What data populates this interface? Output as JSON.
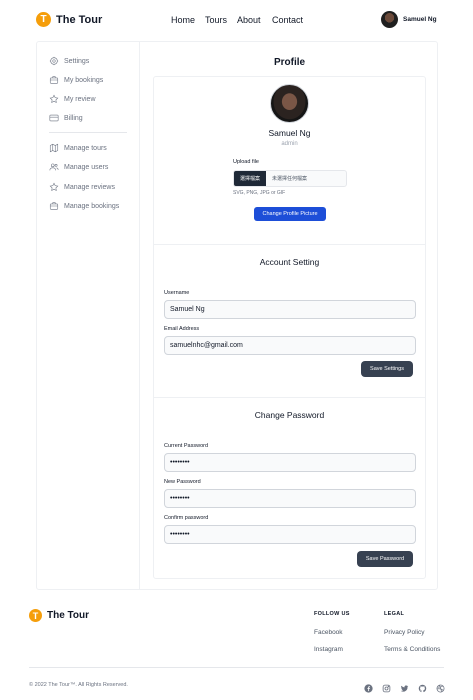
{
  "brand": {
    "logo_letter": "T",
    "name": "The Tour",
    "accent": "#f59e0b"
  },
  "nav": {
    "home": "Home",
    "tours": "Tours",
    "about": "About",
    "contact": "Contact"
  },
  "user": {
    "name": "Samuel Ng"
  },
  "sidebar": {
    "items": [
      {
        "label": "Settings",
        "icon": "gear-icon"
      },
      {
        "label": "My bookings",
        "icon": "briefcase-icon"
      },
      {
        "label": "My review",
        "icon": "star-icon"
      },
      {
        "label": "Billing",
        "icon": "credit-card-icon"
      }
    ],
    "admin_items": [
      {
        "label": "Manage tours",
        "icon": "map-icon"
      },
      {
        "label": "Manage users",
        "icon": "users-icon"
      },
      {
        "label": "Manage reviews",
        "icon": "star-icon"
      },
      {
        "label": "Manage bookings",
        "icon": "briefcase-icon"
      }
    ]
  },
  "profile": {
    "title": "Profile",
    "name": "Samuel Ng",
    "role": "admin",
    "upload_label": "Upload file",
    "file_button": "選擇檔案",
    "file_status": "未選擇任何檔案",
    "file_hint": "SVG, PNG, JPG or GIF",
    "change_picture": "Change Profile Picture"
  },
  "account": {
    "title": "Account Setting",
    "username_label": "Username",
    "username_value": "Samuel Ng",
    "email_label": "Email Address",
    "email_value": "samuelnhc@gmail.com",
    "save": "Save Settings"
  },
  "password": {
    "title": "Change Password",
    "current_label": "Current Password",
    "current_value": "••••••••",
    "new_label": "New Password",
    "new_value": "••••••••",
    "confirm_label": "Confirm password",
    "confirm_value": "••••••••",
    "save": "Save Password"
  },
  "footer": {
    "follow_heading": "FOLLOW US",
    "follow_links": [
      "Facebook",
      "Instagram"
    ],
    "legal_heading": "LEGAL",
    "legal_links": [
      "Privacy Policy",
      "Terms & Conditions"
    ],
    "copyright": "© 2022 The Tour™. All Rights Reserved.",
    "social_icons": [
      "facebook-icon",
      "instagram-icon",
      "twitter-icon",
      "github-icon",
      "dribbble-icon"
    ]
  },
  "colors": {
    "primary_blue": "#1d4ed8",
    "dark_button": "#374151"
  }
}
